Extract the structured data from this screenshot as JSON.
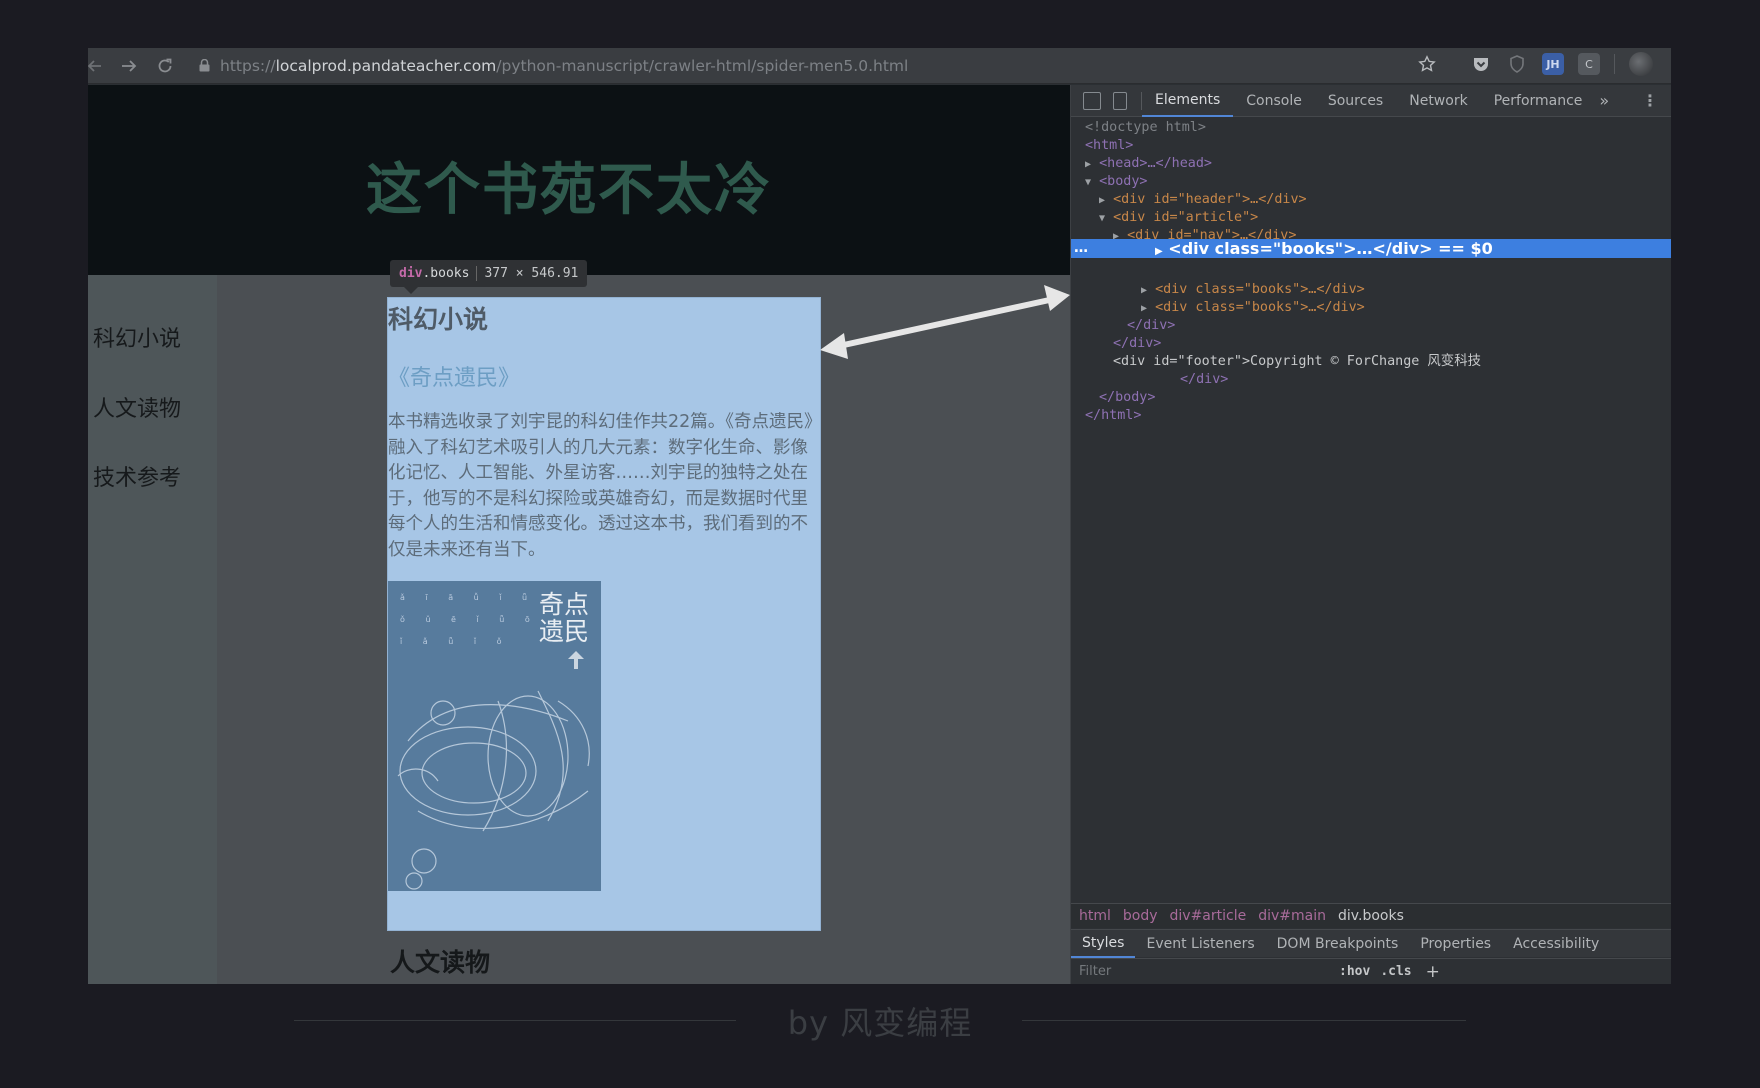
{
  "browser": {
    "url_host_prefix": "https://",
    "url_host": "localprod.pandateacher.com",
    "url_path": "/python-manuscript/crawler-html/spider-men5.0.html",
    "extension_jh": "JH",
    "extension_c": "C"
  },
  "page": {
    "site_title": "这个书苑不太冷",
    "nav": [
      "科幻小说",
      "人文读物",
      "技术参考"
    ],
    "tooltip": {
      "tag": "div",
      "class": ".books",
      "size": "377 × 546.91"
    },
    "book_section": {
      "heading": "科幻小说",
      "title": "《奇点遗民》",
      "description": "本书精选收录了刘宇昆的科幻佳作共22篇。《奇点遗民》融入了科幻艺术吸引人的几大元素：数字化生命、影像化记忆、人工智能、外星访客……刘宇昆的独特之处在于，他写的不是科幻探险或英雄奇幻，而是数据时代里每个人的生活和情感变化。透过这本书，我们看到的不仅是未来还有当下。",
      "cover_title": "奇点遗民"
    },
    "next_heading": "人文读物"
  },
  "devtools": {
    "tabs": [
      "Elements",
      "Console",
      "Sources",
      "Network",
      "Performance"
    ],
    "more": "»",
    "dom": [
      "<!doctype html>",
      "<html>",
      "<head>…</head>",
      "<body>",
      "<div id=\"header\">…</div>",
      "<div id=\"article\">",
      "<div id=\"nav\">…</div>",
      "<div id=\"main\">",
      "<div class=\"books\">…</div> == $0",
      "<div class=\"books\">…</div>",
      "<div class=\"books\">…</div>",
      "</div>",
      "</div>",
      "<div id=\"footer\">Copyright © ForChange 风变科技",
      "</div>",
      "</body>",
      "</html>"
    ],
    "breadcrumbs": [
      "html",
      "body",
      "div#article",
      "div#main",
      "div.books"
    ],
    "style_tabs": [
      "Styles",
      "Event Listeners",
      "DOM Breakpoints",
      "Properties",
      "Accessibility"
    ],
    "filter_placeholder": "Filter",
    "hov": ":hov",
    "cls": ".cls",
    "plus": "+"
  },
  "caption": "by 风变编程"
}
